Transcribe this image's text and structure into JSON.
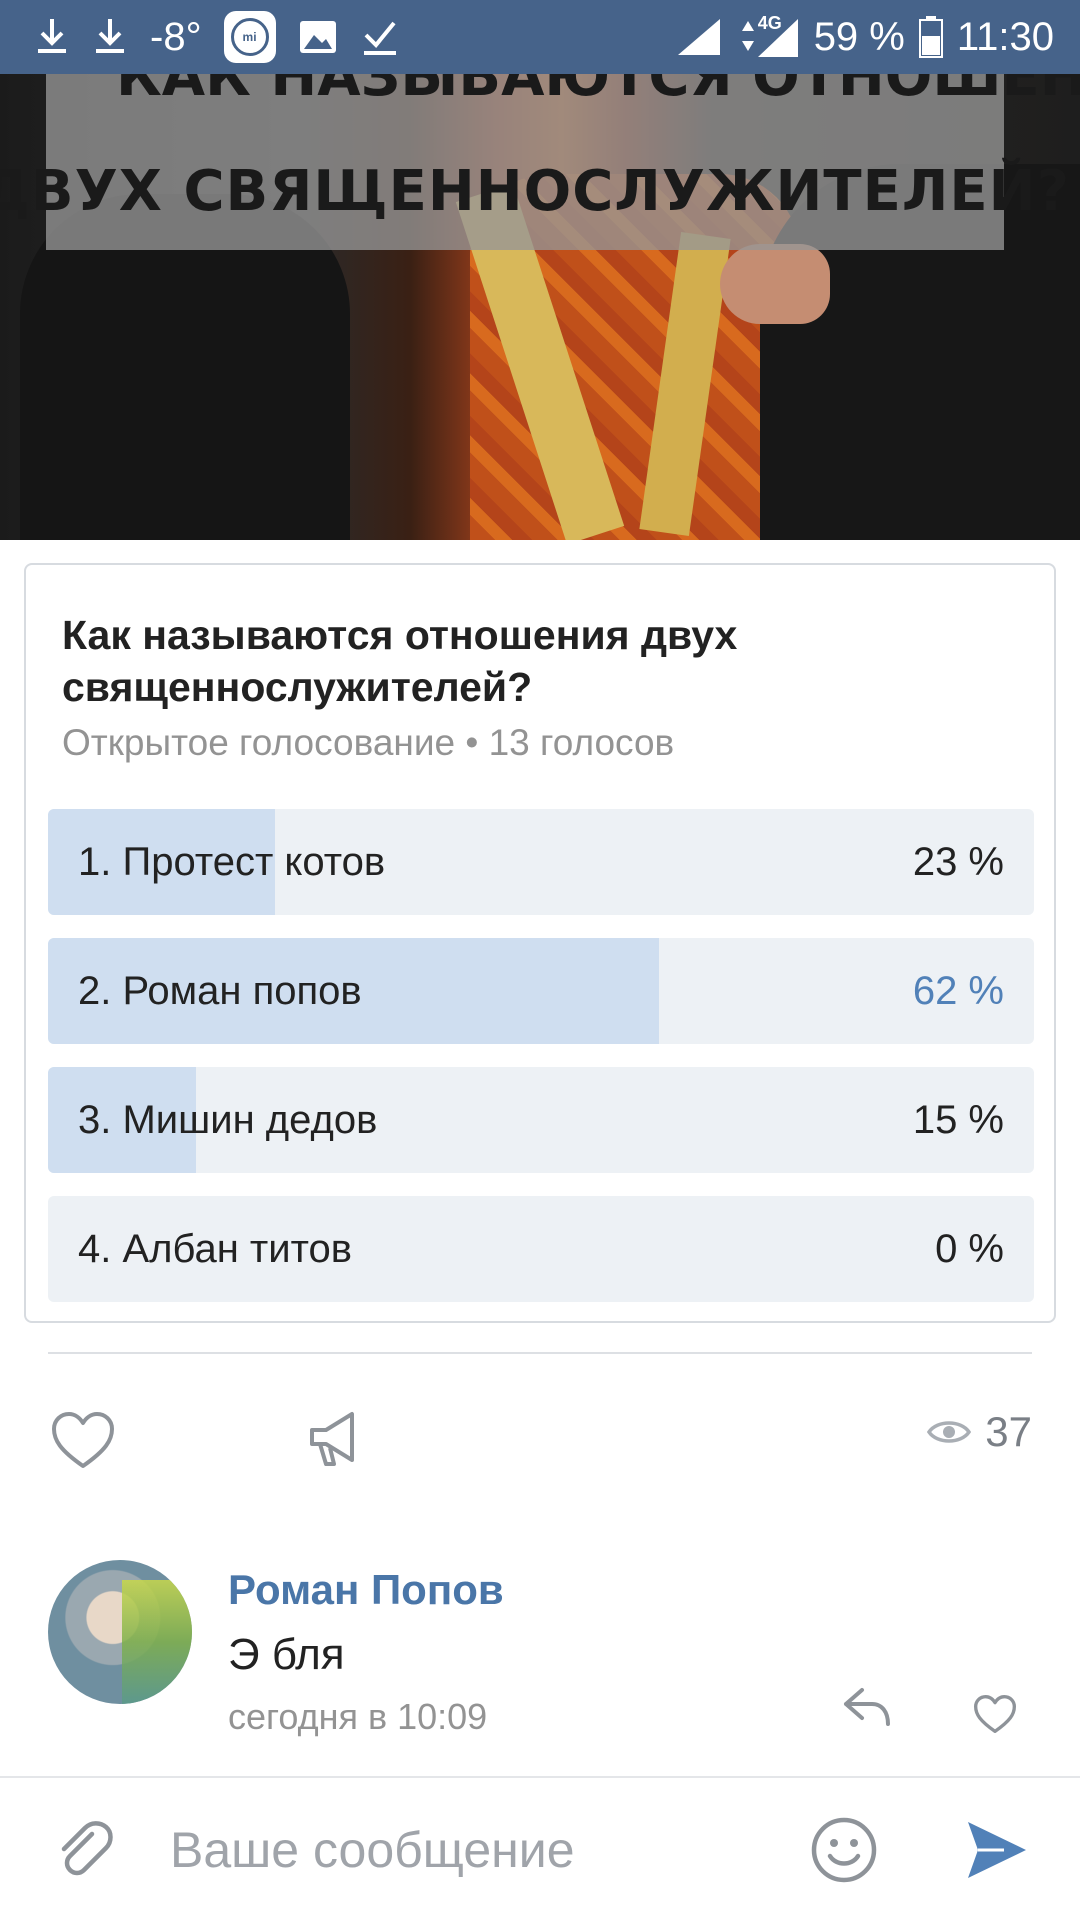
{
  "status_bar": {
    "temperature": "-8°",
    "network": "4G",
    "battery": "59 %",
    "time": "11:30"
  },
  "post_image": {
    "caption_line1": "КАК НАЗЫВАЮТСЯ ОТНОШЕНИЯ",
    "caption_line2": "ДВУХ СВЯЩЕННОСЛУЖИТЕЛЕЙ?"
  },
  "poll": {
    "question": "Как называются отношения двух священнослужителей?",
    "meta": "Открытое голосование • 13 голосов",
    "options": [
      {
        "label": "1. Протест котов",
        "percent_text": "23 %",
        "percent": 23,
        "selected": false
      },
      {
        "label": "2. Роман попов",
        "percent_text": "62 %",
        "percent": 62,
        "selected": true
      },
      {
        "label": "3. Мишин дедов",
        "percent_text": "15 %",
        "percent": 15,
        "selected": false
      },
      {
        "label": "4. Албан титов",
        "percent_text": "0 %",
        "percent": 0,
        "selected": false
      }
    ]
  },
  "actions": {
    "views": "37"
  },
  "comment": {
    "author": "Роман Попов",
    "text": "Э бля",
    "time": "сегодня в 10:09"
  },
  "composer": {
    "placeholder": "Ваше сообщение"
  },
  "colors": {
    "status_bar_bg": "#46638a",
    "accent": "#5181b8",
    "link": "#4a76a8",
    "poll_track": "#edf1f5",
    "poll_fill": "#cfdef0"
  },
  "icons": [
    "download-icon",
    "download-icon",
    "mi-icon",
    "image-icon",
    "check-icon",
    "signal-icon",
    "battery-icon",
    "heart-icon",
    "megaphone-icon",
    "eye-icon",
    "reply-icon",
    "heart-icon",
    "paperclip-icon",
    "smiley-icon",
    "send-icon"
  ]
}
